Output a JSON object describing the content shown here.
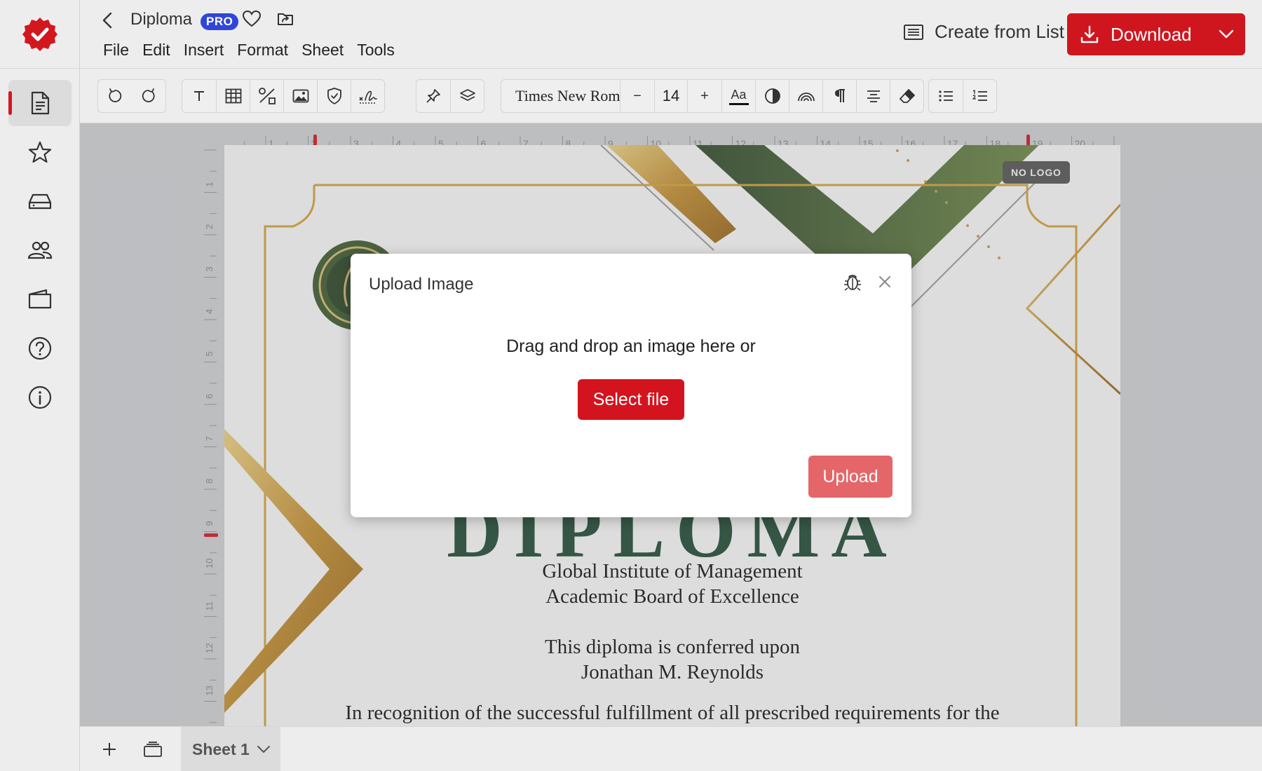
{
  "app": {
    "doc_title": "Diploma",
    "badge": "PRO",
    "menu": [
      "File",
      "Edit",
      "Insert",
      "Format",
      "Sheet",
      "Tools"
    ],
    "create_from_list": "Create from List",
    "download": "Download",
    "accent_color": "#d3171f",
    "badge_color": "#3046d8"
  },
  "sidebar": {
    "icons": [
      "document-icon",
      "star-icon",
      "drive-icon",
      "users-icon",
      "wallet-icon",
      "help-icon",
      "info-icon"
    ]
  },
  "toolbar": {
    "font_name": "Times New Roman",
    "font_size": "14",
    "minus": "−",
    "plus": "+",
    "aa": "Aa"
  },
  "ruler": {
    "h_numbers": [
      "1",
      "2",
      "3",
      "4",
      "5",
      "6",
      "7",
      "8",
      "9",
      "10",
      "11",
      "12",
      "13",
      "14",
      "15",
      "16",
      "17",
      "18",
      "19",
      "20"
    ],
    "v_numbers": [
      "1",
      "2",
      "3",
      "4",
      "5",
      "6",
      "7",
      "8",
      "9",
      "10",
      "11",
      "12",
      "13"
    ]
  },
  "page": {
    "no_logo": "NO LOGO",
    "big_title": "DIPLOMA",
    "institute": "Global Institute of Management",
    "board": "Academic Board of Excellence",
    "conferred": "This diploma is conferred upon",
    "recipient": "Jonathan M. Reynolds",
    "recognition": "In recognition of the successful fulfillment of all prescribed requirements for the"
  },
  "dialog": {
    "title": "Upload Image",
    "prompt": "Drag and drop an image here or",
    "select_file": "Select file",
    "upload": "Upload"
  },
  "bottom": {
    "sheet_tab": "Sheet 1"
  }
}
